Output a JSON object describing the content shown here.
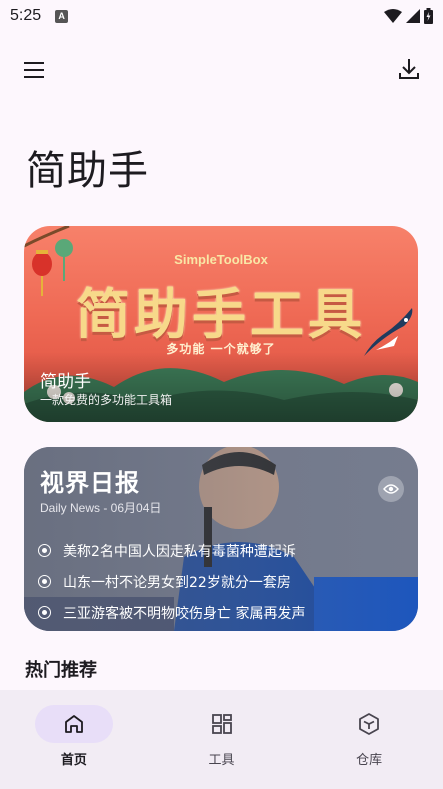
{
  "status_bar": {
    "time": "5:25",
    "notification_letter": "A"
  },
  "app_bar": {
    "menu_icon": "menu-icon",
    "download_icon": "download-icon"
  },
  "page": {
    "title": "简助手"
  },
  "banner": {
    "brand_en": "SimpleToolBox",
    "headline": "简助手工具",
    "slogan": "多功能 一个就够了",
    "title": "简助手",
    "description": "一款免费的多功能工具箱"
  },
  "news": {
    "title": "视界日报",
    "subtitle": "Daily News - 06月04日",
    "items": [
      "美称2名中国人因走私有毒菌种遭起诉",
      "山东一村不论男女到22岁就分一套房",
      "三亚游客被不明物咬伤身亡 家属再发声"
    ],
    "eye_icon": "eye-icon"
  },
  "section": {
    "hot_title": "热门推荐"
  },
  "bottom_nav": {
    "items": [
      {
        "label": "首页",
        "icon": "home-icon",
        "active": true
      },
      {
        "label": "工具",
        "icon": "grid-icon",
        "active": false
      },
      {
        "label": "仓库",
        "icon": "cube-icon",
        "active": false
      }
    ]
  },
  "colors": {
    "background": "#fdf7fd",
    "nav_background": "#f2ecf4",
    "nav_active_pill": "#e8def8",
    "banner_red": "#ef6a55",
    "banner_gold": "#f7d98a"
  }
}
